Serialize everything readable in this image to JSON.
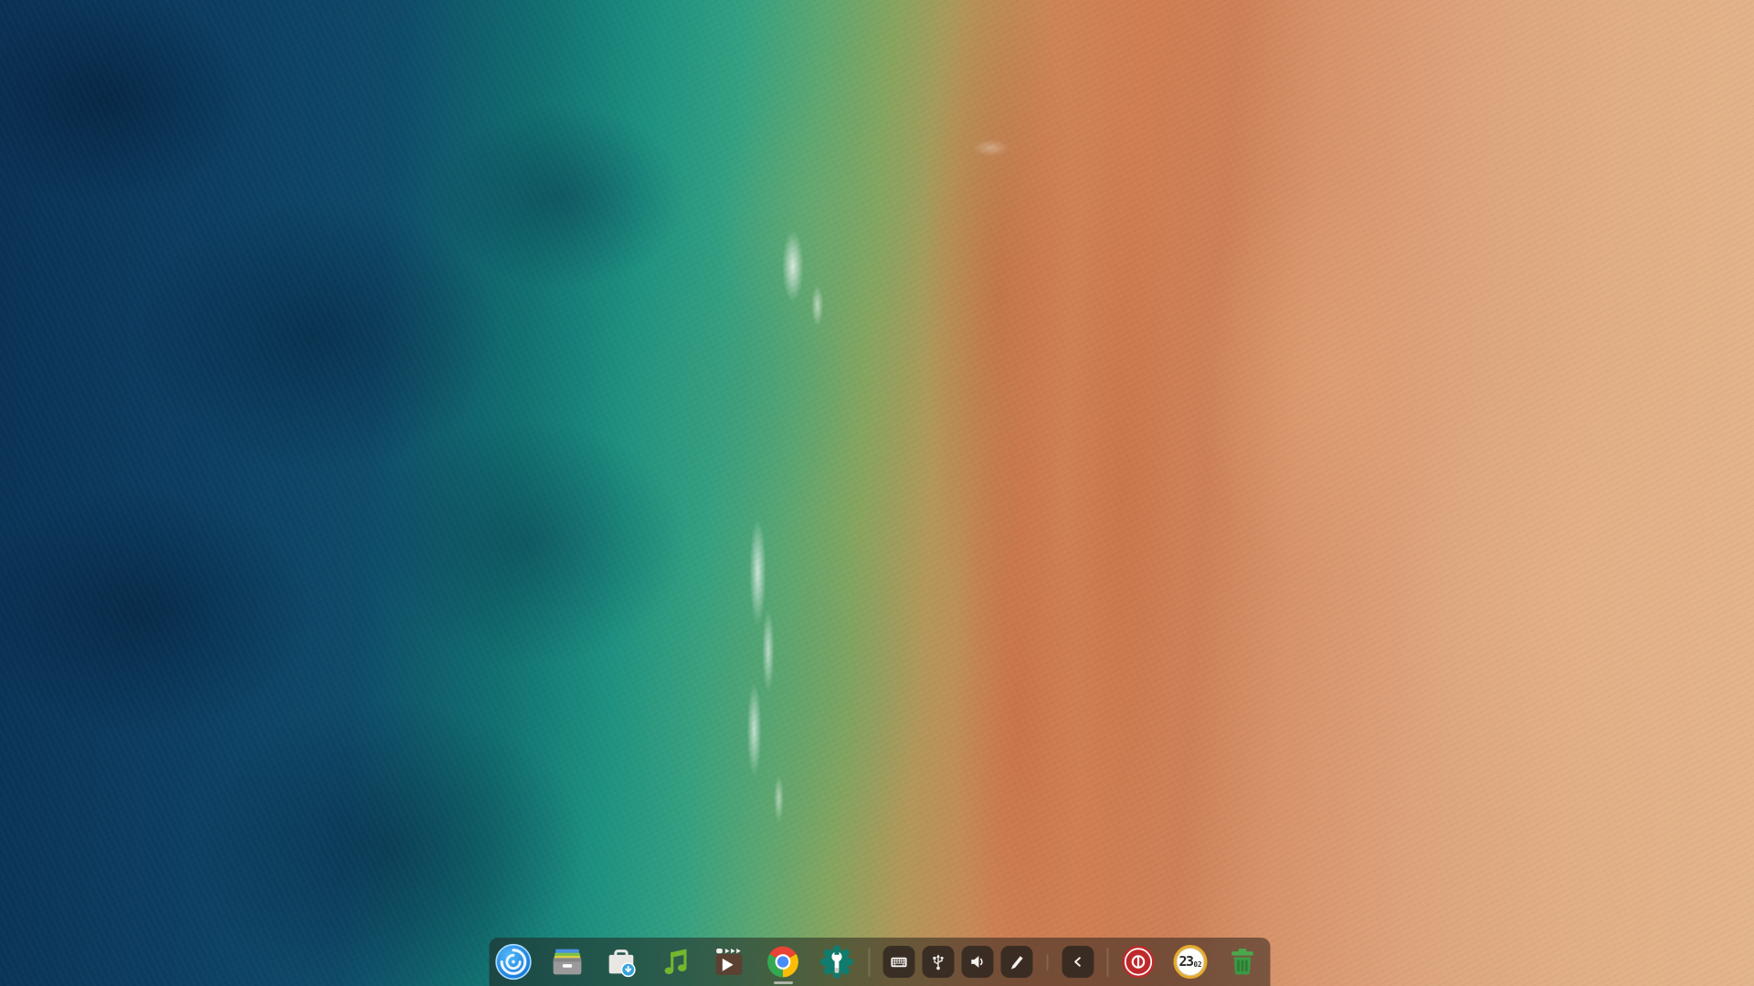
{
  "wallpaper": {
    "description": "Aerial top-down shoreline: deep navy ocean at left blending through teal and green shallows into coral-orange wet sand and pale peach dry sand at right, with white surf streaks along the waterline",
    "colors": {
      "ocean_deep": "#0c3a5e",
      "ocean_teal": "#157d7a",
      "shallows_green": "#45a17d",
      "seagrass_olive": "#86a55f",
      "wet_sand_orange": "#cd8457",
      "dry_sand_peach": "#e4b58c",
      "foam_white": "#ffffff"
    }
  },
  "dock": {
    "background_color": "rgba(36,30,26,0.52)",
    "position": "bottom-center",
    "apps": [
      {
        "name": "launcher",
        "icon": "deepin-launcher-icon",
        "active": false
      },
      {
        "name": "file-manager",
        "icon": "file-manager-icon",
        "active": false
      },
      {
        "name": "app-store",
        "icon": "app-store-icon",
        "active": false
      },
      {
        "name": "music",
        "icon": "music-icon",
        "active": false
      },
      {
        "name": "movie",
        "icon": "movie-icon",
        "active": false
      },
      {
        "name": "chrome",
        "icon": "chrome-icon",
        "active": true
      },
      {
        "name": "control-center",
        "icon": "control-center-icon",
        "active": false
      }
    ],
    "tray": [
      {
        "name": "virtual-keyboard",
        "icon": "keyboard-icon"
      },
      {
        "name": "usb-device",
        "icon": "usb-icon"
      },
      {
        "name": "volume",
        "icon": "speaker-icon"
      },
      {
        "name": "pen-tablet",
        "icon": "pen-icon"
      },
      {
        "name": "collapse-tray",
        "icon": "chevron-left-icon"
      }
    ],
    "plugins": [
      {
        "name": "shutdown",
        "icon": "power-icon",
        "color": "#c0292b"
      },
      {
        "name": "clock",
        "icon": "clock-icon",
        "ring_color": "#e4aa2b"
      },
      {
        "name": "trash",
        "icon": "trash-icon",
        "color": "#3d9a44"
      }
    ],
    "clock": {
      "hour": "23",
      "minute": "02"
    }
  }
}
